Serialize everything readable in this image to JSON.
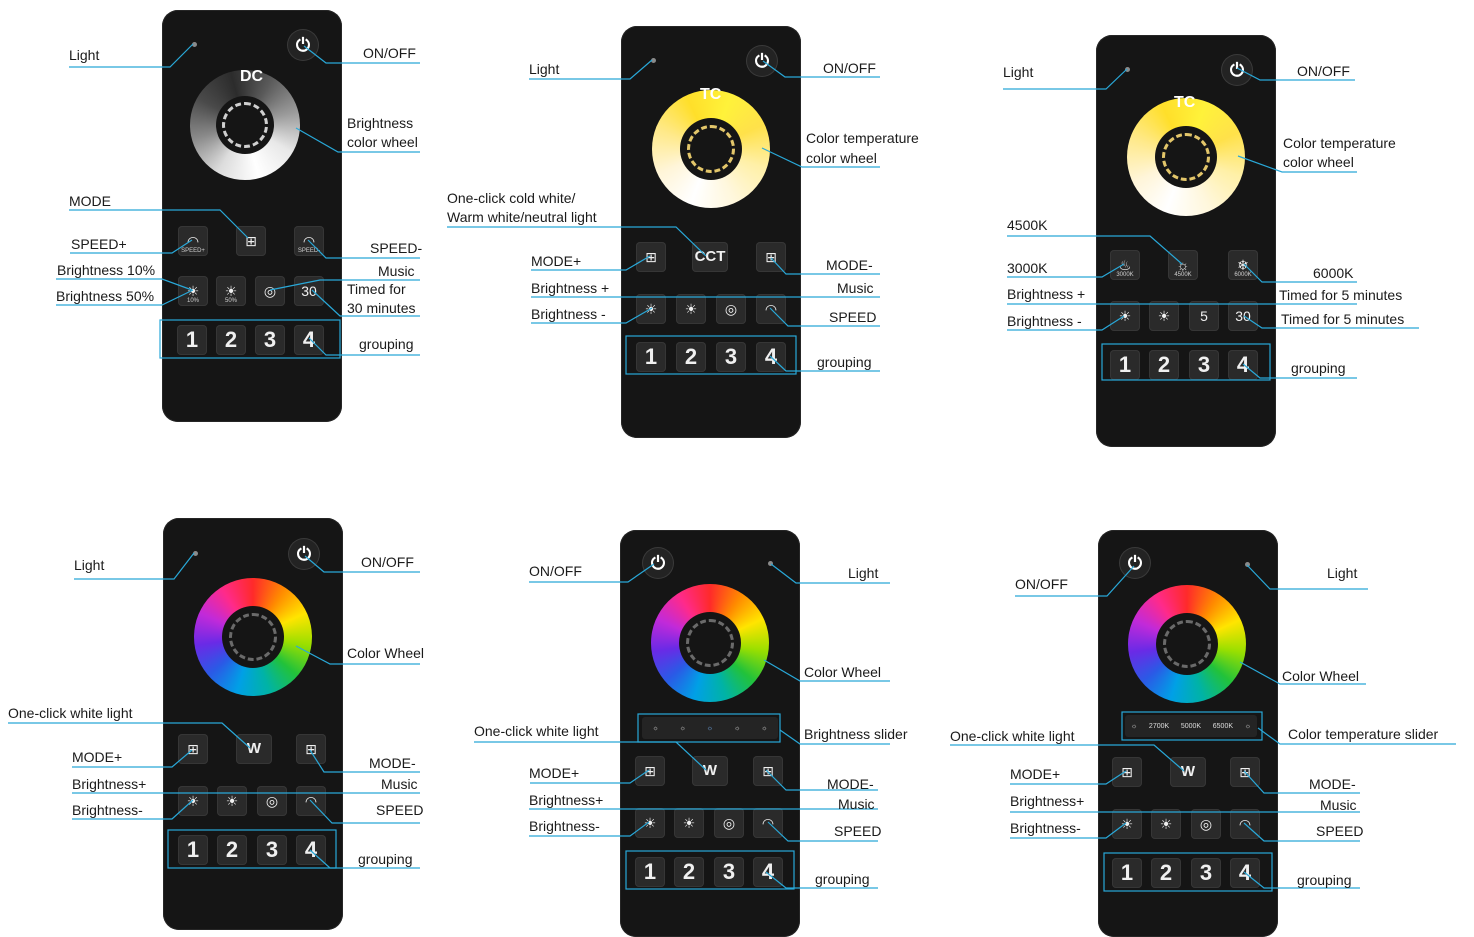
{
  "labels": {
    "light": "Light",
    "on_off": "ON/OFF",
    "brightness_color_wheel_1": "Brightness",
    "brightness_color_wheel_2": "color wheel",
    "color_temp_wheel_1": "Color temperature",
    "color_temp_wheel_2": "color wheel",
    "color_wheel": "Color Wheel",
    "mode": "MODE",
    "speed_plus": "SPEED+",
    "speed_minus": "SPEED-",
    "brightness_10": "Brightness 10%",
    "brightness_50": "Brightness 50%",
    "music": "Music",
    "timed_30_1": "Timed for",
    "timed_30_2": "30 minutes",
    "grouping": "grouping",
    "one_click_cw_1": "One-click cold white/",
    "one_click_cw_2": "Warm white/neutral light",
    "mode_plus": "MODE+",
    "mode_minus": "MODE-",
    "brightness_plus_sp": "Brightness +",
    "brightness_minus_sp": "Brightness -",
    "brightness_plus": "Brightness+",
    "brightness_minus": "Brightness-",
    "speed": "SPEED",
    "k4500": "4500K",
    "k3000": "3000K",
    "k6000": "6000K",
    "timed_5": "Timed for 5 minutes",
    "one_click_white": "One-click white light",
    "brightness_slider": "Brightness slider",
    "color_temp_slider": "Color temperature slider"
  },
  "remotes": {
    "dc": {
      "tag": "DC"
    },
    "tc": {
      "tag": "TC"
    },
    "tc6": {
      "tag": "TC"
    }
  },
  "keys": {
    "power": "⏻",
    "group": [
      "1",
      "2",
      "3",
      "4"
    ],
    "cct": "CCT",
    "white": "W",
    "mode": "⊞",
    "sun": "☀",
    "music": "◎",
    "speed": "◠",
    "timer": "◔",
    "speed_plus_sub": "SPEED+",
    "speed_minus_sub": "SPEED-",
    "b10_sub": "10%",
    "b50_sub": "50%",
    "t30": "30",
    "t5": "5",
    "k3000_sub": "3000K",
    "k4500_sub": "4500K",
    "k6000_sub": "6000K"
  },
  "sliders": {
    "ct": [
      "2700K",
      "5000K",
      "6500K"
    ]
  },
  "icons": {
    "power": "power-icon",
    "mode": "mode-grid-icon",
    "sun": "sun-icon",
    "music": "music-icon",
    "speed": "speed-gauge-icon",
    "timer": "timer-icon"
  },
  "colors": {
    "accent_line": "#29a8d8",
    "remote_body": "#151515",
    "key_bg": "#2a2a2a"
  }
}
